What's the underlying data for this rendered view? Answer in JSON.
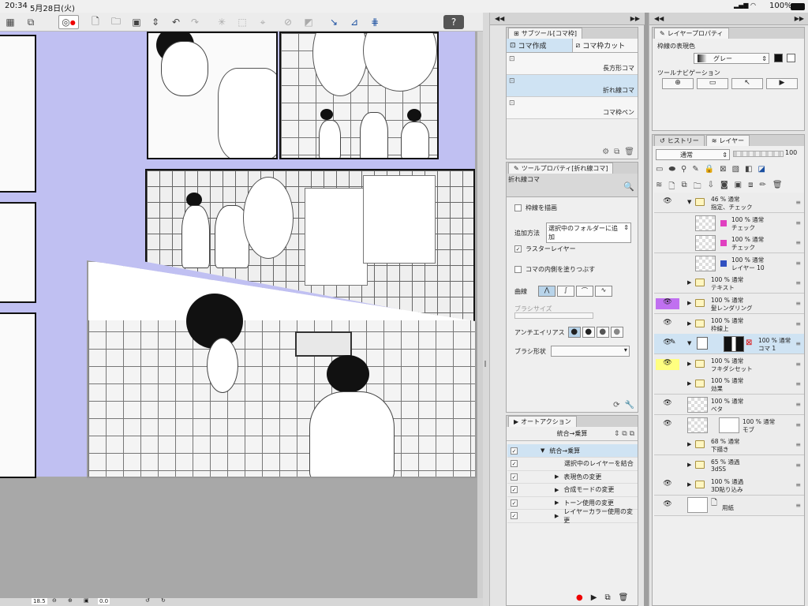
{
  "statusbar": {
    "time": "20:34",
    "date": "5月28日(火)",
    "battery": "100%"
  },
  "toolbar": {
    "icons": [
      "grid-menu-icon",
      "layer-menu-icon",
      "swirl-icon",
      "new-file-icon",
      "open-folder-icon",
      "save-icon",
      "arrow-updown-icon",
      "undo-icon",
      "redo-icon",
      "transform-icon",
      "crop-icon",
      "deform-icon",
      "clear-icon",
      "fill-icon",
      "pen-icon",
      "ruler-icon",
      "snap-icon",
      "help-icon"
    ]
  },
  "subtool": {
    "title": "サブツール[コマ枠]",
    "tab_create": "コマ作成",
    "tab_cut": "コマ枠カット",
    "items": [
      "長方形コマ",
      "折れ線コマ",
      "コマ枠ペン"
    ],
    "selected_index": 1
  },
  "toolprop": {
    "title": "ツールプロパティ[折れ線コマ]",
    "tool_name": "折れ線コマ",
    "draw_line": "枠線を描画",
    "add_method_label": "追加方法",
    "add_method_value": "選択中のフォルダーに追加",
    "raster_layer": "ラスターレイヤー",
    "fill_inside": "コマの内側を塗りつぶす",
    "curve_label": "曲線",
    "brush_size_label": "ブラシサイズ",
    "antialias_label": "アンチエイリアス",
    "brush_shape_label": "ブラシ形状"
  },
  "autoaction": {
    "title": "オートアクション",
    "set_name": "統合→乗算",
    "items": [
      "統合→乗算",
      "選択中のレイヤーを結合",
      "表現色の変更",
      "合成モードの変更",
      "トーン使用の変更",
      "レイヤーカラー使用の変更"
    ]
  },
  "layerprop": {
    "title": "レイヤープロパティ",
    "expression_label": "枠線の表現色",
    "expression_value": "グレー",
    "nav_label": "ツールナビゲーション"
  },
  "layerpanel": {
    "tab_history": "ヒストリー",
    "tab_layer": "レイヤー",
    "blend_mode": "通常",
    "opacity": "100",
    "layers": [
      {
        "line1": "46 % 通常",
        "line2": "指定、チェック",
        "type": "folder",
        "eye": true,
        "color": ""
      },
      {
        "line1": "100 % 通常",
        "line2": "チェック",
        "type": "raster",
        "eye": false,
        "color": ""
      },
      {
        "line1": "100 % 通常",
        "line2": "チェック",
        "type": "raster",
        "eye": false,
        "color": ""
      },
      {
        "line1": "100 % 通常",
        "line2": "レイヤー 10",
        "type": "raster",
        "eye": false,
        "color": ""
      },
      {
        "line1": "100 % 通常",
        "line2": "テキスト",
        "type": "folder",
        "eye": false,
        "color": ""
      },
      {
        "line1": "100 % 通常",
        "line2": "髪レンダリング",
        "type": "folder",
        "eye": true,
        "color": "#c070f0"
      },
      {
        "line1": "100 % 通常",
        "line2": "枠線上",
        "type": "folder",
        "eye": true,
        "color": ""
      },
      {
        "line1": "100 % 通常",
        "line2": "コマ 1",
        "type": "frame",
        "eye": true,
        "color": ""
      },
      {
        "line1": "100 % 通常",
        "line2": "フキダシセット",
        "type": "folder",
        "eye": true,
        "color": "#ffff80"
      },
      {
        "line1": "100 % 通常",
        "line2": "効果",
        "type": "folder",
        "eye": false,
        "color": ""
      },
      {
        "line1": "100 % 通常",
        "line2": "ベタ",
        "type": "raster",
        "eye": true,
        "color": ""
      },
      {
        "line1": "100 % 通常",
        "line2": "モブ",
        "type": "masked",
        "eye": true,
        "color": ""
      },
      {
        "line1": "68 % 通常",
        "line2": "下描き",
        "type": "folder",
        "eye": false,
        "color": ""
      },
      {
        "line1": "65 % 通過",
        "line2": "3dSS",
        "type": "folder",
        "eye": false,
        "color": ""
      },
      {
        "line1": "100 % 通過",
        "line2": "3D貼り込み",
        "type": "folder",
        "eye": true,
        "color": ""
      },
      {
        "line1": "",
        "line2": "用紙",
        "type": "paper",
        "eye": true,
        "color": ""
      }
    ]
  },
  "zoombar": {
    "zoom": "18.5",
    "angle": "0.0"
  }
}
